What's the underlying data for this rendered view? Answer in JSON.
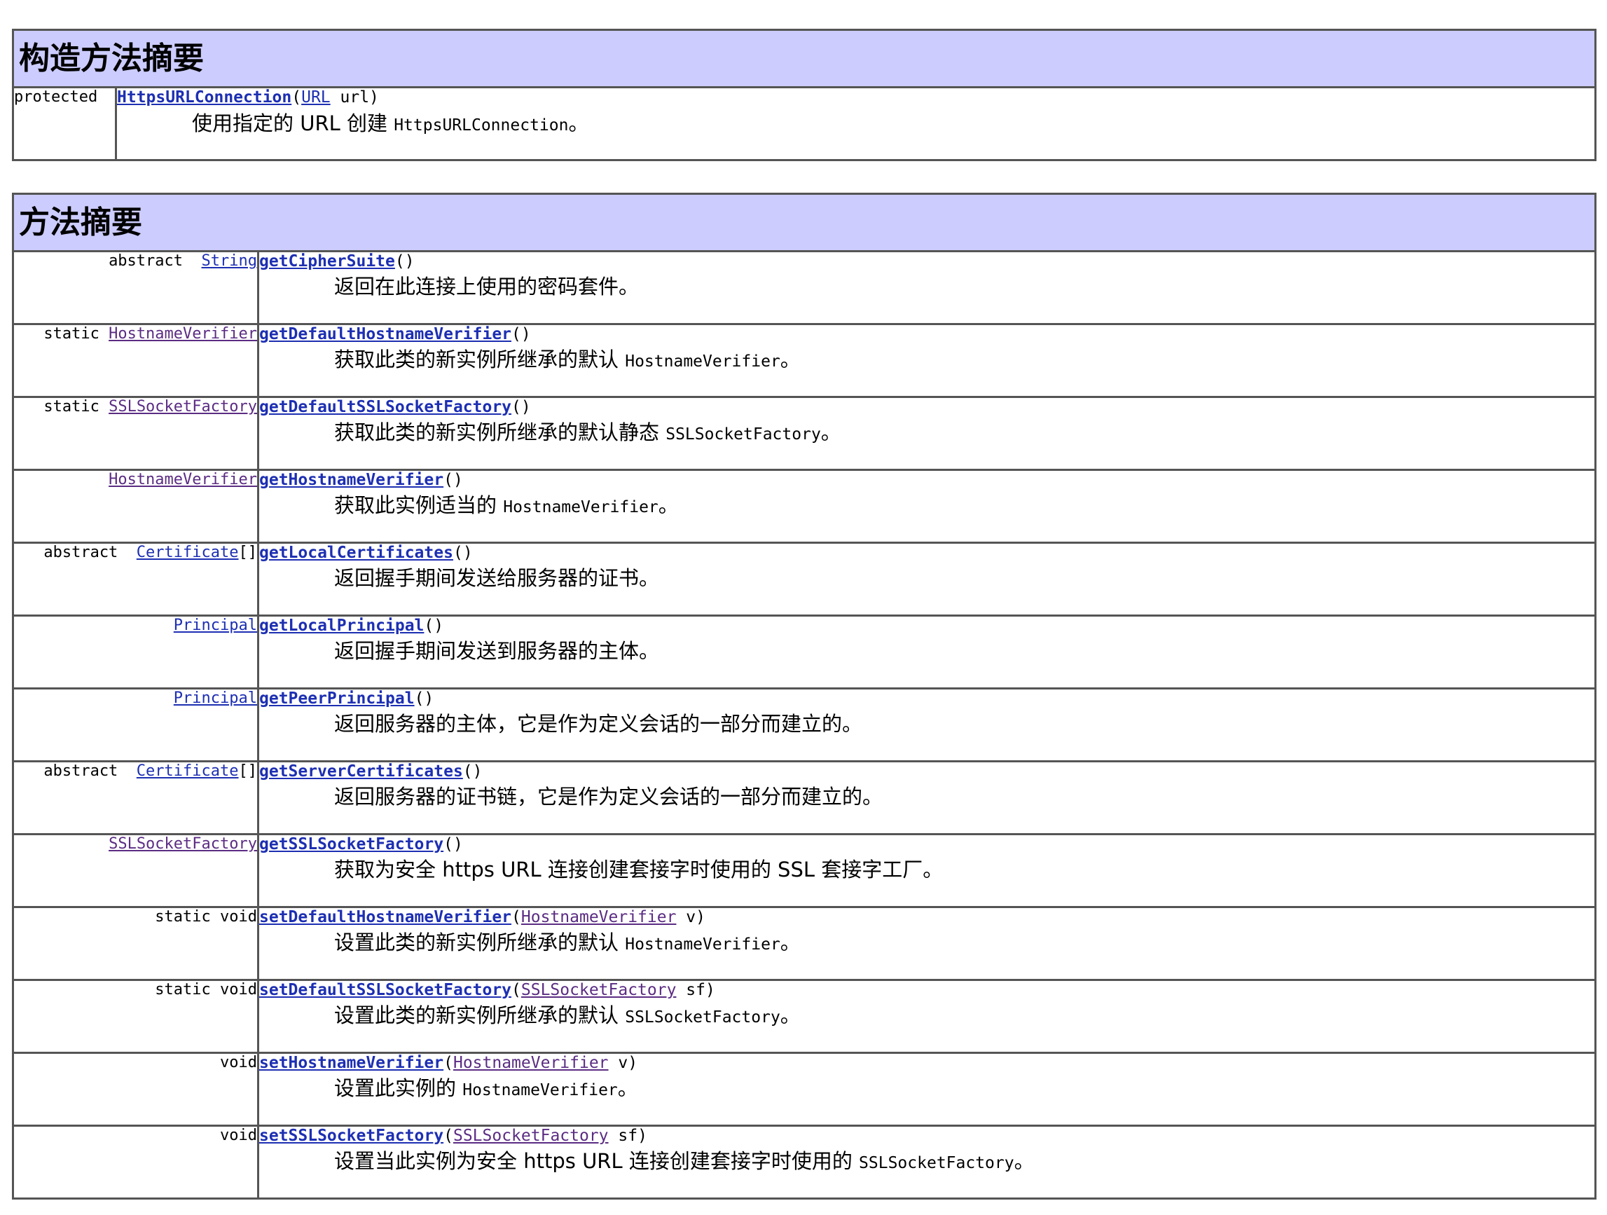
{
  "constructor_summary": {
    "title": "构造方法摘要",
    "rows": [
      {
        "modifier": "protected",
        "name": "HttpsURLConnection",
        "params": [
          {
            "type": "URL",
            "type_visited": false,
            "name": "url"
          }
        ],
        "desc_before": "使用指定的 URL 创建 ",
        "desc_code": "HttpsURLConnection",
        "desc_after": "。"
      }
    ]
  },
  "method_summary": {
    "title": "方法摘要",
    "rows": [
      {
        "modifier": "abstract  ",
        "return_type": "String",
        "return_visited": false,
        "return_suffix": "",
        "name": "getCipherSuite",
        "params": [],
        "desc_before": "返回在此连接上使用的密码套件。",
        "desc_code": "",
        "desc_after": ""
      },
      {
        "modifier": "static ",
        "return_type": "HostnameVerifier",
        "return_visited": true,
        "return_suffix": "",
        "name": "getDefaultHostnameVerifier",
        "params": [],
        "desc_before": "获取此类的新实例所继承的默认 ",
        "desc_code": "HostnameVerifier",
        "desc_after": "。"
      },
      {
        "modifier": "static ",
        "return_type": "SSLSocketFactory",
        "return_visited": true,
        "return_suffix": "",
        "name": "getDefaultSSLSocketFactory",
        "params": [],
        "desc_before": "获取此类的新实例所继承的默认静态 ",
        "desc_code": "SSLSocketFactory",
        "desc_after": "。"
      },
      {
        "modifier": "",
        "return_type": "HostnameVerifier",
        "return_visited": true,
        "return_suffix": "",
        "name": "getHostnameVerifier",
        "params": [],
        "desc_before": "获取此实例适当的 ",
        "desc_code": "HostnameVerifier",
        "desc_after": "。"
      },
      {
        "modifier": "abstract  ",
        "return_type": "Certificate",
        "return_visited": false,
        "return_suffix": "[]",
        "name": "getLocalCertificates",
        "params": [],
        "desc_before": "返回握手期间发送给服务器的证书。",
        "desc_code": "",
        "desc_after": ""
      },
      {
        "modifier": "",
        "return_type": "Principal",
        "return_visited": false,
        "return_suffix": "",
        "name": "getLocalPrincipal",
        "params": [],
        "desc_before": "返回握手期间发送到服务器的主体。",
        "desc_code": "",
        "desc_after": ""
      },
      {
        "modifier": "",
        "return_type": "Principal",
        "return_visited": false,
        "return_suffix": "",
        "name": "getPeerPrincipal",
        "params": [],
        "desc_before": "返回服务器的主体，它是作为定义会话的一部分而建立的。",
        "desc_code": "",
        "desc_after": ""
      },
      {
        "modifier": "abstract  ",
        "return_type": "Certificate",
        "return_visited": false,
        "return_suffix": "[]",
        "name": "getServerCertificates",
        "params": [],
        "desc_before": "返回服务器的证书链，它是作为定义会话的一部分而建立的。",
        "desc_code": "",
        "desc_after": ""
      },
      {
        "modifier": "",
        "return_type": "SSLSocketFactory",
        "return_visited": true,
        "return_suffix": "",
        "name": "getSSLSocketFactory",
        "params": [],
        "desc_before": "获取为安全 https URL 连接创建套接字时使用的 SSL 套接字工厂。",
        "desc_code": "",
        "desc_after": ""
      },
      {
        "modifier": "static void",
        "return_type": "",
        "return_visited": false,
        "return_suffix": "",
        "name": "setDefaultHostnameVerifier",
        "params": [
          {
            "type": "HostnameVerifier",
            "type_visited": true,
            "name": "v"
          }
        ],
        "desc_before": "设置此类的新实例所继承的默认 ",
        "desc_code": "HostnameVerifier",
        "desc_after": "。"
      },
      {
        "modifier": "static void",
        "return_type": "",
        "return_visited": false,
        "return_suffix": "",
        "name": "setDefaultSSLSocketFactory",
        "params": [
          {
            "type": "SSLSocketFactory",
            "type_visited": true,
            "name": "sf"
          }
        ],
        "desc_before": "设置此类的新实例所继承的默认 ",
        "desc_code": "SSLSocketFactory",
        "desc_after": "。"
      },
      {
        "modifier": "void",
        "return_type": "",
        "return_visited": false,
        "return_suffix": "",
        "name": "setHostnameVerifier",
        "params": [
          {
            "type": "HostnameVerifier",
            "type_visited": true,
            "name": "v"
          }
        ],
        "desc_before": "设置此实例的 ",
        "desc_code": "HostnameVerifier",
        "desc_after": "。"
      },
      {
        "modifier": "void",
        "return_type": "",
        "return_visited": false,
        "return_suffix": "",
        "name": "setSSLSocketFactory",
        "params": [
          {
            "type": "SSLSocketFactory",
            "type_visited": true,
            "name": "sf"
          }
        ],
        "desc_before": "设置当此实例为安全 https URL 连接创建套接字时使用的 ",
        "desc_code": "SSLSocketFactory",
        "desc_after": "。"
      }
    ]
  },
  "colors": {
    "header_bg": "#ccccff",
    "border": "#555555",
    "link": "#1d2fb2",
    "visited_link": "#5b2c83"
  }
}
